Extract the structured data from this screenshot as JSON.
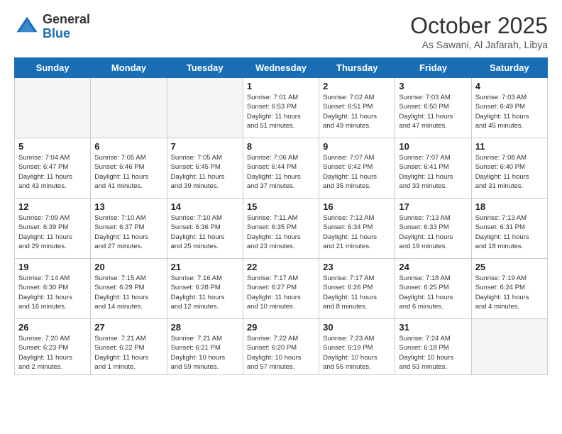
{
  "header": {
    "logo_general": "General",
    "logo_blue": "Blue",
    "month_title": "October 2025",
    "location": "As Sawani, Al Jafarah, Libya"
  },
  "days_of_week": [
    "Sunday",
    "Monday",
    "Tuesday",
    "Wednesday",
    "Thursday",
    "Friday",
    "Saturday"
  ],
  "weeks": [
    [
      {
        "day": "",
        "info": ""
      },
      {
        "day": "",
        "info": ""
      },
      {
        "day": "",
        "info": ""
      },
      {
        "day": "1",
        "info": "Sunrise: 7:01 AM\nSunset: 6:53 PM\nDaylight: 11 hours\nand 51 minutes."
      },
      {
        "day": "2",
        "info": "Sunrise: 7:02 AM\nSunset: 6:51 PM\nDaylight: 11 hours\nand 49 minutes."
      },
      {
        "day": "3",
        "info": "Sunrise: 7:03 AM\nSunset: 6:50 PM\nDaylight: 11 hours\nand 47 minutes."
      },
      {
        "day": "4",
        "info": "Sunrise: 7:03 AM\nSunset: 6:49 PM\nDaylight: 11 hours\nand 45 minutes."
      }
    ],
    [
      {
        "day": "5",
        "info": "Sunrise: 7:04 AM\nSunset: 6:47 PM\nDaylight: 11 hours\nand 43 minutes."
      },
      {
        "day": "6",
        "info": "Sunrise: 7:05 AM\nSunset: 6:46 PM\nDaylight: 11 hours\nand 41 minutes."
      },
      {
        "day": "7",
        "info": "Sunrise: 7:05 AM\nSunset: 6:45 PM\nDaylight: 11 hours\nand 39 minutes."
      },
      {
        "day": "8",
        "info": "Sunrise: 7:06 AM\nSunset: 6:44 PM\nDaylight: 11 hours\nand 37 minutes."
      },
      {
        "day": "9",
        "info": "Sunrise: 7:07 AM\nSunset: 6:42 PM\nDaylight: 11 hours\nand 35 minutes."
      },
      {
        "day": "10",
        "info": "Sunrise: 7:07 AM\nSunset: 6:41 PM\nDaylight: 11 hours\nand 33 minutes."
      },
      {
        "day": "11",
        "info": "Sunrise: 7:08 AM\nSunset: 6:40 PM\nDaylight: 11 hours\nand 31 minutes."
      }
    ],
    [
      {
        "day": "12",
        "info": "Sunrise: 7:09 AM\nSunset: 6:39 PM\nDaylight: 11 hours\nand 29 minutes."
      },
      {
        "day": "13",
        "info": "Sunrise: 7:10 AM\nSunset: 6:37 PM\nDaylight: 11 hours\nand 27 minutes."
      },
      {
        "day": "14",
        "info": "Sunrise: 7:10 AM\nSunset: 6:36 PM\nDaylight: 11 hours\nand 25 minutes."
      },
      {
        "day": "15",
        "info": "Sunrise: 7:11 AM\nSunset: 6:35 PM\nDaylight: 11 hours\nand 23 minutes."
      },
      {
        "day": "16",
        "info": "Sunrise: 7:12 AM\nSunset: 6:34 PM\nDaylight: 11 hours\nand 21 minutes."
      },
      {
        "day": "17",
        "info": "Sunrise: 7:13 AM\nSunset: 6:33 PM\nDaylight: 11 hours\nand 19 minutes."
      },
      {
        "day": "18",
        "info": "Sunrise: 7:13 AM\nSunset: 6:31 PM\nDaylight: 11 hours\nand 18 minutes."
      }
    ],
    [
      {
        "day": "19",
        "info": "Sunrise: 7:14 AM\nSunset: 6:30 PM\nDaylight: 11 hours\nand 16 minutes."
      },
      {
        "day": "20",
        "info": "Sunrise: 7:15 AM\nSunset: 6:29 PM\nDaylight: 11 hours\nand 14 minutes."
      },
      {
        "day": "21",
        "info": "Sunrise: 7:16 AM\nSunset: 6:28 PM\nDaylight: 11 hours\nand 12 minutes."
      },
      {
        "day": "22",
        "info": "Sunrise: 7:17 AM\nSunset: 6:27 PM\nDaylight: 11 hours\nand 10 minutes."
      },
      {
        "day": "23",
        "info": "Sunrise: 7:17 AM\nSunset: 6:26 PM\nDaylight: 11 hours\nand 8 minutes."
      },
      {
        "day": "24",
        "info": "Sunrise: 7:18 AM\nSunset: 6:25 PM\nDaylight: 11 hours\nand 6 minutes."
      },
      {
        "day": "25",
        "info": "Sunrise: 7:19 AM\nSunset: 6:24 PM\nDaylight: 11 hours\nand 4 minutes."
      }
    ],
    [
      {
        "day": "26",
        "info": "Sunrise: 7:20 AM\nSunset: 6:23 PM\nDaylight: 11 hours\nand 2 minutes."
      },
      {
        "day": "27",
        "info": "Sunrise: 7:21 AM\nSunset: 6:22 PM\nDaylight: 11 hours\nand 1 minute."
      },
      {
        "day": "28",
        "info": "Sunrise: 7:21 AM\nSunset: 6:21 PM\nDaylight: 10 hours\nand 59 minutes."
      },
      {
        "day": "29",
        "info": "Sunrise: 7:22 AM\nSunset: 6:20 PM\nDaylight: 10 hours\nand 57 minutes."
      },
      {
        "day": "30",
        "info": "Sunrise: 7:23 AM\nSunset: 6:19 PM\nDaylight: 10 hours\nand 55 minutes."
      },
      {
        "day": "31",
        "info": "Sunrise: 7:24 AM\nSunset: 6:18 PM\nDaylight: 10 hours\nand 53 minutes."
      },
      {
        "day": "",
        "info": ""
      }
    ]
  ]
}
